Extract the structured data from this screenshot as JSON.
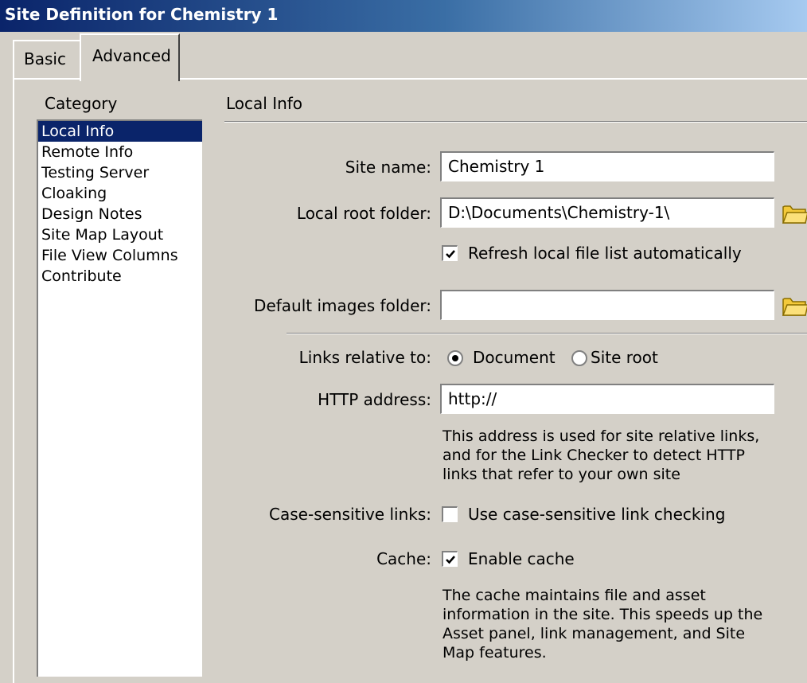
{
  "window": {
    "title": "Site Definition for Chemistry 1"
  },
  "tabs": [
    {
      "label": "Basic",
      "active": false
    },
    {
      "label": "Advanced",
      "active": true
    }
  ],
  "category": {
    "label": "Category",
    "items": [
      "Local Info",
      "Remote Info",
      "Testing Server",
      "Cloaking",
      "Design Notes",
      "Site Map Layout",
      "File View Columns",
      "Contribute"
    ],
    "selected": "Local Info"
  },
  "local_info": {
    "title": "Local Info",
    "site_name": {
      "label": "Site name:",
      "value": "Chemistry 1"
    },
    "local_root": {
      "label": "Local root folder:",
      "value": "D:\\Documents\\Chemistry-1\\"
    },
    "refresh": {
      "label": "Refresh local file list automatically",
      "checked": true
    },
    "default_images": {
      "label": "Default images folder:",
      "value": ""
    },
    "links_relative": {
      "label": "Links relative to:",
      "options": [
        "Document",
        "Site root"
      ],
      "selected": "Document"
    },
    "http": {
      "label": "HTTP address:",
      "value": "http://",
      "help": [
        "This address is used for site relative links,",
        "and for the Link Checker to detect HTTP",
        "links that refer to your own site"
      ]
    },
    "case_sensitive": {
      "label": "Case-sensitive links:",
      "option": "Use case-sensitive link checking",
      "checked": false
    },
    "cache": {
      "label": "Cache:",
      "option": "Enable cache",
      "checked": true,
      "help": [
        "The cache maintains file and asset",
        "information in the site.  This speeds up the",
        "Asset panel, link management, and Site",
        "Map features."
      ]
    }
  },
  "colors": {
    "dialog_bg": "#d4d0c8",
    "title_gradient_start": "#0a246a",
    "title_gradient_end": "#a6caf0",
    "selection": "#0a246a",
    "folder": "#f3c93a"
  },
  "icons": [
    "folder-icon",
    "checkmark-icon"
  ]
}
